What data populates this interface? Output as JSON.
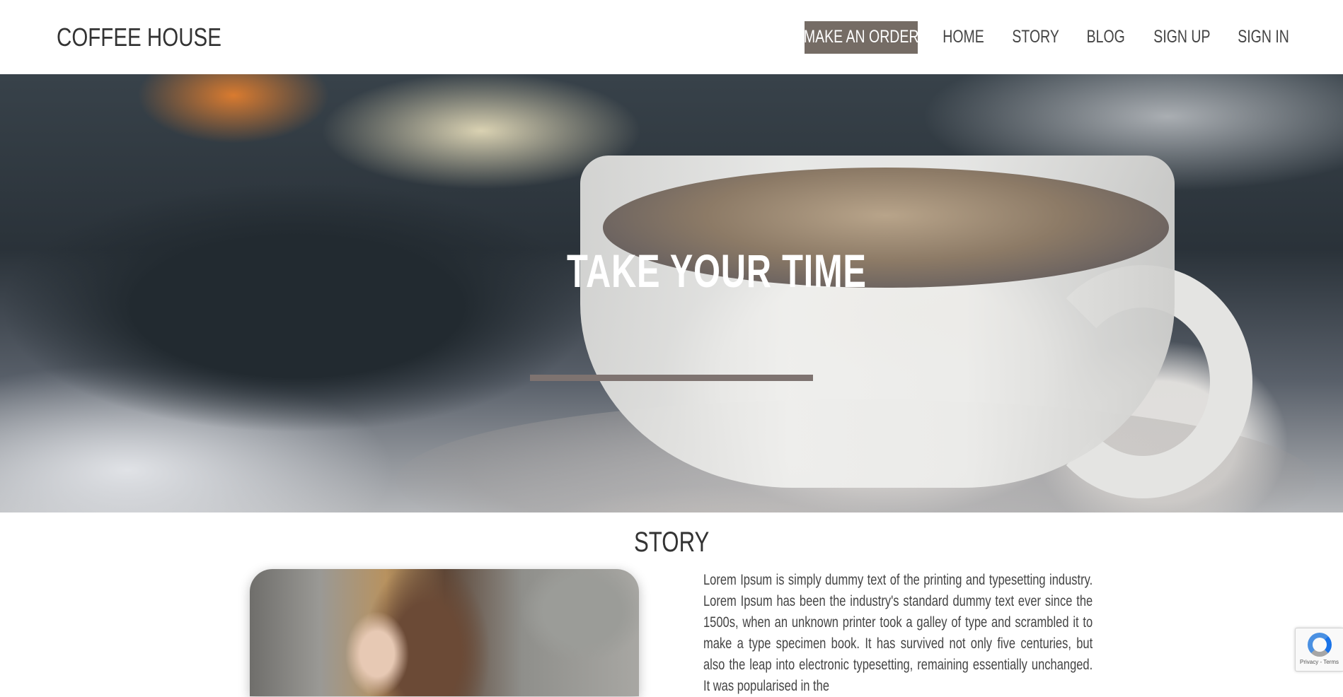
{
  "header": {
    "logo": "COFFEE HOUSE",
    "nav": {
      "order": "MAKE AN ORDER",
      "home": "HOME",
      "story": "STORY",
      "blog": "BLOG",
      "signup": "SIGN UP",
      "signin": "SIGN IN"
    }
  },
  "hero": {
    "title": "TAKE YOUR TIME"
  },
  "story": {
    "heading": "STORY",
    "paragraph": "Lorem Ipsum is simply dummy text of the printing and typesetting industry. Lorem Ipsum has been the industry's standard dummy text ever since the 1500s, when an unknown printer took a galley of type and scrambled it to make a type specimen book. It has survived not only five centuries, but also the leap into electronic typesetting, remaining essentially unchanged. It was popularised in the"
  },
  "recaptcha": {
    "text": "Privacy - Terms"
  },
  "colors": {
    "accent": "#756c65",
    "underline": "#7e7370",
    "text": "#333333"
  }
}
